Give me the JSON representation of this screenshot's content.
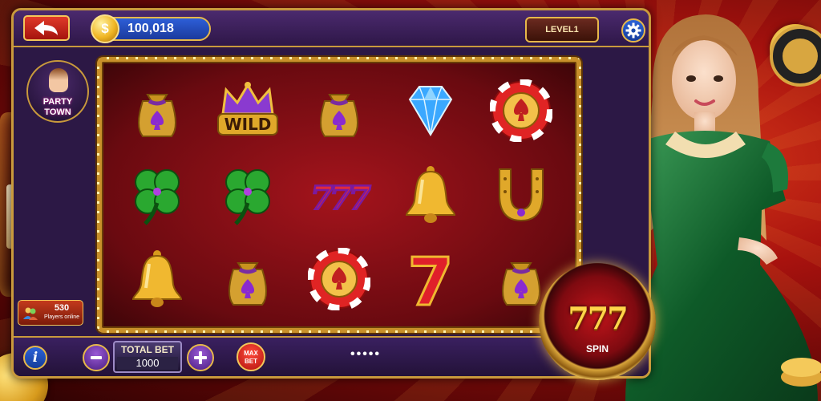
{
  "header": {
    "balance": "100,018",
    "coin_symbol": "$",
    "level": "LEVEL1"
  },
  "logo": {
    "line1": "PARTY",
    "line2": "TOWN"
  },
  "reels": [
    [
      "money-bag-spade",
      "wild-crown",
      "money-bag-spade",
      "blue-diamond",
      "poker-chip-spade"
    ],
    [
      "four-leaf-clover",
      "four-leaf-clover",
      "triple-seven",
      "golden-bell",
      "golden-horseshoe"
    ],
    [
      "golden-bell",
      "money-bag-spade",
      "poker-chip-spade",
      "red-seven",
      "money-bag-spade"
    ]
  ],
  "symbol_text": {
    "wild": "WILD",
    "triple_seven": "777",
    "seven": "7"
  },
  "players": {
    "count": "530",
    "label": "Players online"
  },
  "bet": {
    "label": "TOTAL BET",
    "value": "1000",
    "max_label_1": "MAX",
    "max_label_2": "BET"
  },
  "pager": "•••••",
  "spin": {
    "numbers": "777",
    "label": "SPIN"
  },
  "background": {
    "machine_reels": [
      "7",
      "7",
      "7"
    ]
  },
  "colors": {
    "frame": "#2c1845",
    "gold": "#c99a3c",
    "accent_blue": "#2c63d8",
    "accent_red": "#e03a2a"
  }
}
